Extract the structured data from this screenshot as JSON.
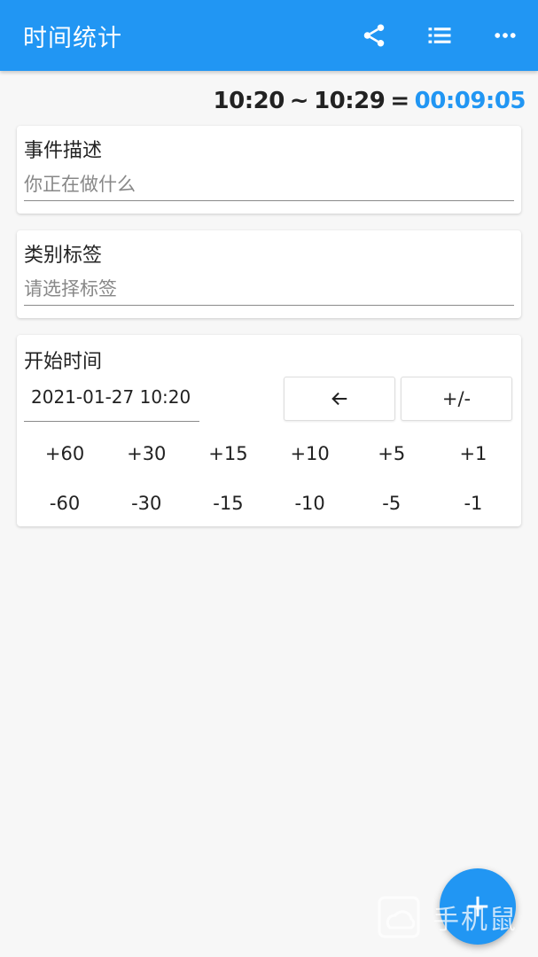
{
  "appbar": {
    "title": "时间统计",
    "actions": [
      "share-icon",
      "list-icon",
      "more-icon"
    ]
  },
  "duration": {
    "start": "10:20",
    "separator": "~",
    "end": "10:29",
    "equals": "=",
    "total": "00:09:05"
  },
  "event_card": {
    "label": "事件描述",
    "placeholder": "你正在做什么",
    "value": ""
  },
  "category_card": {
    "label": "类别标签",
    "placeholder": "请选择标签",
    "value": ""
  },
  "start_card": {
    "label": "开始时间",
    "datetime": "2021-01-27 10:20",
    "back_button": "←",
    "sign_button": "+/-",
    "plus": [
      "+60",
      "+30",
      "+15",
      "+10",
      "+5",
      "+1"
    ],
    "minus": [
      "-60",
      "-30",
      "-15",
      "-10",
      "-5",
      "-1"
    ]
  },
  "fab": {
    "icon": "add-icon"
  },
  "watermark": {
    "text": "手机鼠"
  },
  "colors": {
    "primary": "#2196f3",
    "background": "#f7f7f7"
  }
}
